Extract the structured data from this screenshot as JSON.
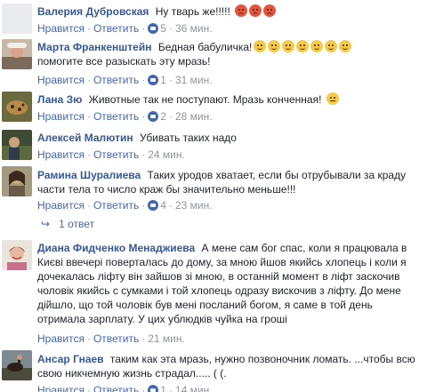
{
  "common": {
    "like_label": "Нравится",
    "reply_label": "Ответить",
    "dot": "·"
  },
  "comments": [
    {
      "author": "Валерия Дубровская",
      "text": "Ну тварь же!!!!!",
      "emoji": [
        "angry-face",
        "angry-face",
        "angry-face"
      ],
      "likes": "5",
      "time": "36 мин."
    },
    {
      "author": "Марта Франкенштейн",
      "text": "Бедная бабуличка!",
      "text2": "помогите все разыскать эту мразь!",
      "emoji": [
        "laughing-face",
        "laughing-face",
        "laughing-face",
        "laughing-face",
        "laughing-face",
        "laughing-face",
        "laughing-face"
      ],
      "likes": "1",
      "time": "31 мин."
    },
    {
      "author": "Лана Зю",
      "text": "Животные так не поступают. Мразь конченная!",
      "emoji": [
        "annoyed-face"
      ],
      "likes": "2",
      "time": "28 мин."
    },
    {
      "author": "Алексей Малютин",
      "text": "Убивать таких надо",
      "time": "24 мин."
    },
    {
      "author": "Рамина Шуралиева",
      "text": "Таких уродов хватает, если бы отрубывали за краду части тела то число краж бы значительно меньше!!!",
      "likes": "4",
      "time": "23 мин.",
      "replies": "1 ответ"
    },
    {
      "author": "Диана Фидченко Менаджиева",
      "text": "А мене сам бог спас, коли я працювала в Києві ввечері поверталась до дому, за мною йшов якийсь хлопець і коли я дочекалась ліфту він зайшов зі мною, в останній момент в ліфт заскочив чоловік якийсь с сумками і той хлопець одразу вискочив з ліфту. До мене дійшло, що той чоловік був мені посланий богом, я саме в той день отримала зарплату. У цих ублюдків чуйка на гроші",
      "time": "21 мин."
    },
    {
      "author": "Ансар Гнаев",
      "text": "таким как эта мразь, нужно позвоночник ломать. ...чтобы всю свою никчемную жизнь страдал..... ( (.",
      "likes": "1",
      "time": "14 мин."
    }
  ],
  "colors": {
    "link": "#365899",
    "action": "#4267b2",
    "meta": "#90949c",
    "text": "#1d2129"
  }
}
